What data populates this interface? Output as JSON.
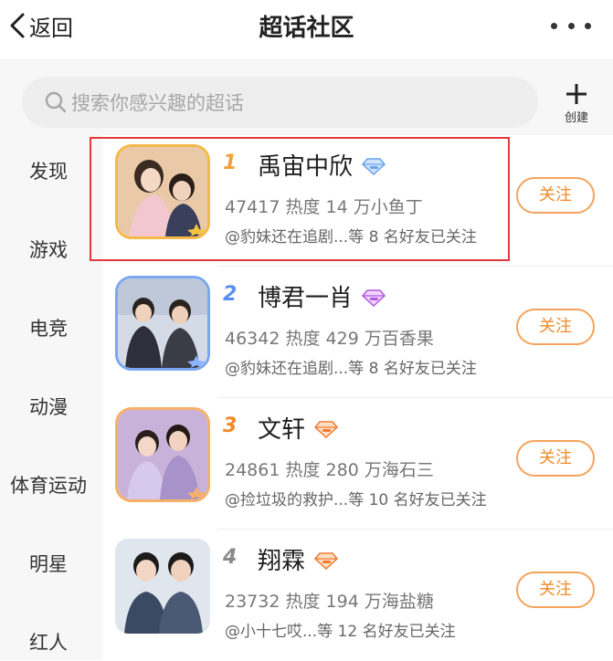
{
  "header": {
    "back_label": "返回",
    "title": "超话社区",
    "back_icon": "chevron-left-icon",
    "more_icon": "more-dots-icon"
  },
  "search": {
    "placeholder": "搜索你感兴趣的超话",
    "icon": "search-icon"
  },
  "create": {
    "label": "创建",
    "icon": "plus-icon"
  },
  "sidebar": {
    "items": [
      {
        "label": "发现"
      },
      {
        "label": "游戏"
      },
      {
        "label": "电竞"
      },
      {
        "label": "动漫"
      },
      {
        "label": "体育运动"
      },
      {
        "label": "明星"
      },
      {
        "label": "红人"
      }
    ]
  },
  "list": {
    "items": [
      {
        "rank": "1",
        "name": "禹宙中欣",
        "stats": "47417 热度 14 万小鱼丁",
        "friends": "@豹妹还在追剧...等 8 名好友已关注",
        "follow": "关注",
        "badge": "diamond-blue-icon"
      },
      {
        "rank": "2",
        "name": "博君一肖",
        "stats": "46342 热度 429 万百香果",
        "friends": "@豹妹还在追剧...等 8 名好友已关注",
        "follow": "关注",
        "badge": "diamond-purple-icon"
      },
      {
        "rank": "3",
        "name": "文轩",
        "stats": "24861 热度 280 万海石三",
        "friends": "@捡垃圾的救护...等 10 名好友已关注",
        "follow": "关注",
        "badge": "diamond-orange-icon"
      },
      {
        "rank": "4",
        "name": "翔霖",
        "stats": "23732 热度 194 万海盐糖",
        "friends": "@小十七哎...等 12 名好友已关注",
        "follow": "关注",
        "badge": "diamond-orange-icon"
      }
    ]
  },
  "colors": {
    "accent_orange": "#f08a2a",
    "highlight_red": "#e03a3a",
    "rank_1": "#f0a23a",
    "rank_2": "#5b8ef0",
    "rank_3": "#f08a2a",
    "rank_4": "#8a8a8a"
  }
}
